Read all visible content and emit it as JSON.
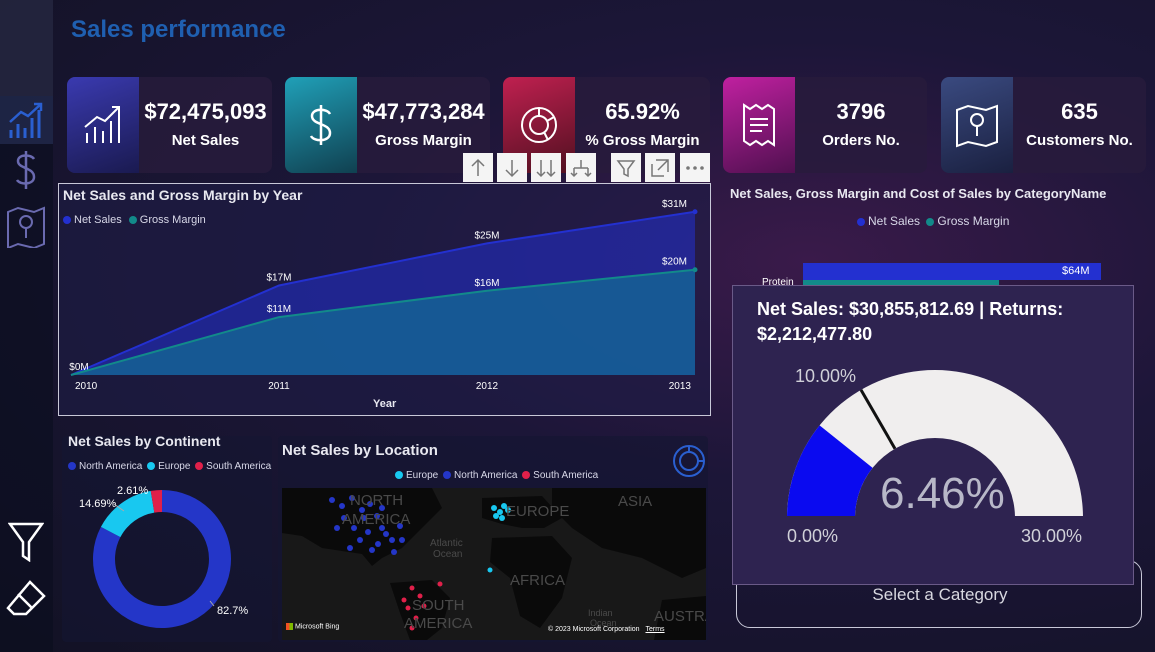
{
  "page": {
    "title": "Sales performance"
  },
  "kpis": [
    {
      "value": "$72,475,093",
      "label": "Net Sales",
      "icon": "chart-growth-icon",
      "color": "#2a2a8a"
    },
    {
      "value": "$47,773,284",
      "label": "Gross Margin",
      "icon": "dollar-icon",
      "color": "#1a7a8a"
    },
    {
      "value": "65.92%",
      "label": "% Gross Margin",
      "icon": "donut-icon",
      "color": "#8a1a4a"
    },
    {
      "value": "3796",
      "label": "Orders No.",
      "icon": "receipt-icon",
      "color": "#8a1a8a"
    },
    {
      "value": "635",
      "label": "Customers No.",
      "icon": "map-pin-icon",
      "color": "#2a3a6a"
    }
  ],
  "line_panel": {
    "title": "Net Sales and Gross Margin by Year",
    "legend": [
      "Net Sales",
      "Gross Margin"
    ],
    "xlabel": "Year"
  },
  "bar_panel": {
    "title": "Net Sales, Gross Margin and Cost of Sales by CategoryName",
    "legend": [
      "Net Sales",
      "Gross Margin"
    ],
    "category": "Protein",
    "value_label": "$64M"
  },
  "donut_panel": {
    "title": "Net Sales by Continent",
    "legend": [
      "North America",
      "Europe",
      "South America"
    ]
  },
  "map_panel": {
    "title": "Net Sales by Location",
    "legend": [
      "Europe",
      "North America",
      "South America"
    ],
    "labels": [
      "NORTH",
      "AMERICA",
      "EUROPE",
      "ASIA",
      "Atlantic",
      "Ocean",
      "AFRICA",
      "SOUTH",
      "AMERICA",
      "Indian",
      "Ocean",
      "AUSTRA"
    ],
    "attribution": "Microsoft Bing",
    "copyright": "© 2023 Microsoft Corporation",
    "terms": "Terms"
  },
  "tooltip": {
    "line1": "Net Sales: $30,855,812.69 | Returns:",
    "line2": "$2,212,477.80",
    "gauge_value": "6.46%",
    "gauge_min": "0.00%",
    "gauge_max": "30.00%",
    "gauge_target": "10.00%",
    "value_num": 6.46,
    "min_num": 0,
    "max_num": 30,
    "target_num": 10
  },
  "select_category": "Select a Category",
  "colors": {
    "net_sales": "#2330d0",
    "gross_margin": "#128a8a",
    "north_america": "#2436c8",
    "europe": "#18c8f0",
    "south_america": "#e0204a",
    "gauge_fill": "#0a0af0",
    "gauge_track": "#f0eeee"
  },
  "chart_data": [
    {
      "type": "area",
      "title": "Net Sales and Gross Margin by Year",
      "xlabel": "Year",
      "ylabel": "",
      "x": [
        "2010",
        "2011",
        "2012",
        "2013"
      ],
      "series": [
        {
          "name": "Net Sales",
          "values": [
            0,
            17,
            25,
            31
          ],
          "labels": [
            "$0M",
            "$17M",
            "$25M",
            "$31M"
          ]
        },
        {
          "name": "Gross Margin",
          "values": [
            0,
            11,
            16,
            20
          ],
          "labels": [
            "",
            "$11M",
            "$16M",
            "$20M"
          ]
        }
      ],
      "ylim": [
        0,
        34
      ],
      "legend": "top-left"
    },
    {
      "type": "pie",
      "title": "Net Sales by Continent",
      "categories": [
        "North America",
        "Europe",
        "South America"
      ],
      "values": [
        82.7,
        14.69,
        2.61
      ],
      "labels": [
        "82.7%",
        "14.69%",
        "2.61%"
      ],
      "legend": "top"
    }
  ]
}
